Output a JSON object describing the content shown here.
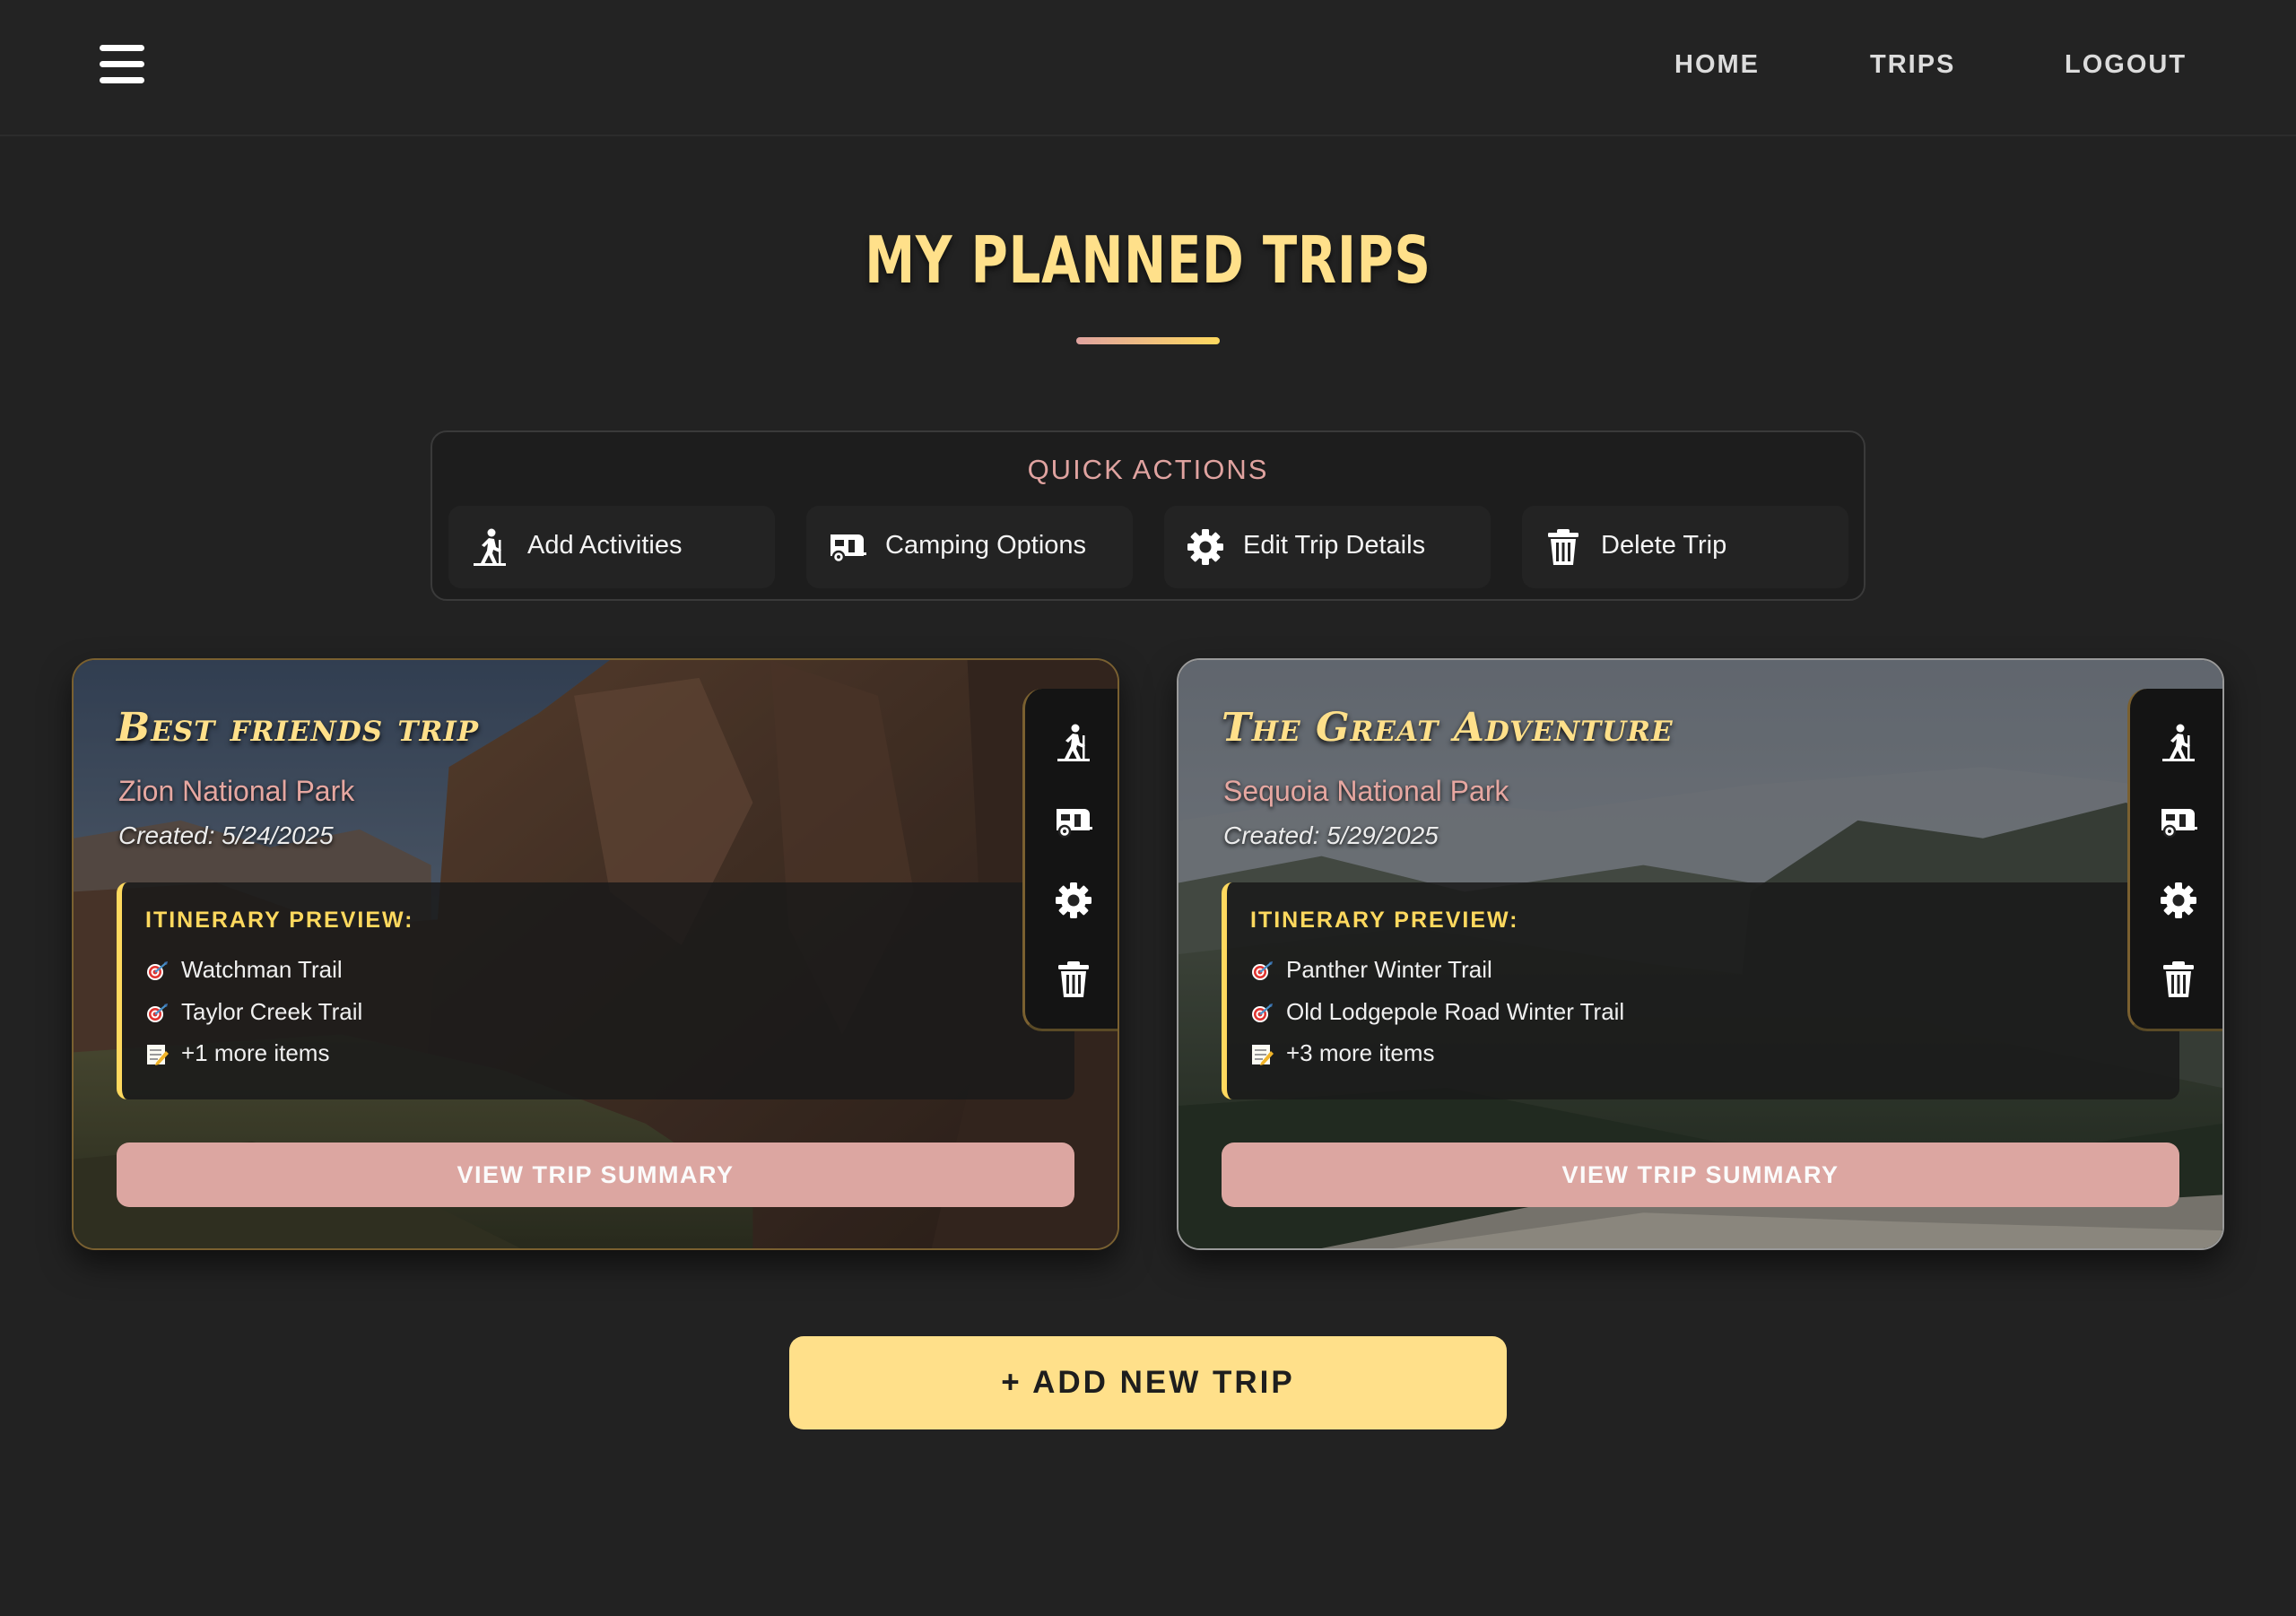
{
  "nav": {
    "menu_icon": "hamburger-icon",
    "links": [
      "HOME",
      "TRIPS",
      "LOGOUT"
    ]
  },
  "page": {
    "title": "MY PLANNED TRIPS"
  },
  "quick_actions": {
    "title": "QUICK ACTIONS",
    "buttons": [
      {
        "label": "Add Activities",
        "icon": "hiker-icon"
      },
      {
        "label": "Camping Options",
        "icon": "camper-icon"
      },
      {
        "label": "Edit Trip Details",
        "icon": "gear-icon"
      },
      {
        "label": "Delete Trip",
        "icon": "trash-icon"
      }
    ]
  },
  "trips": [
    {
      "name": "Best friends trip",
      "park": "Zion National Park",
      "created": "Created: 5/24/2025",
      "itinerary_title": "ITINERARY PREVIEW:",
      "items": [
        "Watchman Trail",
        "Taylor Creek Trail",
        "+1 more items"
      ],
      "view_label": "VIEW TRIP SUMMARY"
    },
    {
      "name": "The Great Adventure",
      "park": "Sequoia National Park",
      "created": "Created: 5/29/2025",
      "itinerary_title": "ITINERARY PREVIEW:",
      "items": [
        "Panther Winter Trail",
        "Old Lodgepole Road Winter Trail",
        "+3 more items"
      ],
      "view_label": "VIEW TRIP SUMMARY"
    }
  ],
  "add_trip_label": "+ ADD NEW TRIP",
  "colors": {
    "background": "#222222",
    "accent_yellow": "#ffe08a",
    "accent_pink": "#dca6a1",
    "panel": "#1d1d1d"
  }
}
